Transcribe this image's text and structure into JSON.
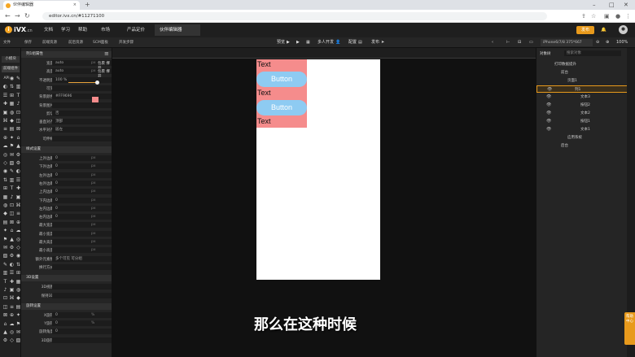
{
  "browser": {
    "tab_title": "伙伴编辑器",
    "url": "editor.ivx.cn/#11271100",
    "new_tab": "+",
    "tab_close": "×"
  },
  "app": {
    "logo_text": "iVX",
    "logo_sub": ".cn",
    "menus": [
      "文档",
      "学习",
      "帮助",
      "市场",
      "产品定价"
    ],
    "project_tab": "伙伴编辑器",
    "publish_label": "发布"
  },
  "toolbar": {
    "left": [
      "文件",
      "保存",
      "前端资源",
      "前后资源",
      "SCM面板",
      "开发步骤"
    ],
    "center": [
      "预览",
      "多人开发",
      "配置",
      "发布"
    ],
    "device": "iPhone6/7/8 375*667",
    "zoom": "100%"
  },
  "sidebar": {
    "top_label": "小模块",
    "active_label": "前端组件",
    "rows": [
      [
        "API",
        "",
        "",
        ""
      ],
      [
        "",
        "",
        "",
        ""
      ],
      [
        "",
        "",
        "",
        ""
      ],
      [
        "",
        "",
        "",
        ""
      ],
      [
        "",
        "",
        "",
        ""
      ],
      [
        "",
        "",
        "",
        ""
      ],
      [
        "",
        "",
        "",
        ""
      ],
      [
        "",
        "",
        "",
        ""
      ],
      [
        "",
        "",
        "",
        ""
      ],
      [
        "",
        "",
        "",
        ""
      ],
      [
        "",
        "",
        "",
        ""
      ],
      [
        "",
        "",
        "",
        ""
      ],
      [
        "",
        "",
        "",
        ""
      ],
      [
        "",
        "",
        "",
        ""
      ],
      [
        "",
        "",
        "",
        ""
      ],
      [
        "",
        "",
        "",
        ""
      ],
      [
        "",
        "",
        "",
        ""
      ],
      [
        "",
        "",
        "",
        ""
      ],
      [
        "",
        "",
        "",
        ""
      ],
      [
        "",
        "",
        "",
        ""
      ],
      [
        "",
        "",
        "",
        ""
      ],
      [
        "",
        "",
        "",
        ""
      ],
      [
        "",
        "",
        "",
        ""
      ],
      [
        "",
        "",
        "",
        ""
      ],
      [
        "",
        "",
        "",
        ""
      ],
      [
        "",
        "",
        "",
        ""
      ],
      [
        "",
        "",
        "",
        ""
      ],
      [
        "",
        "",
        "",
        ""
      ],
      [
        "",
        "",
        "",
        ""
      ],
      [
        "",
        "",
        "",
        ""
      ],
      [
        "",
        "",
        "",
        ""
      ],
      [
        "",
        "",
        "",
        ""
      ]
    ]
  },
  "props": {
    "header": "列1组属性",
    "rows": [
      {
        "label": "宽度",
        "value": "auto",
        "unit": "px",
        "extra": "包裹 撑开"
      },
      {
        "label": "高度",
        "value": "auto",
        "unit": "px",
        "extra": "包裹 撑开"
      },
      {
        "label": "不透明度",
        "value": "100 %"
      },
      {
        "label": "可见",
        "value": ""
      },
      {
        "label": "背景颜色",
        "value": "#FF9696"
      },
      {
        "label": "背景图片",
        "value": ""
      },
      {
        "label": "剪切",
        "value": "否"
      },
      {
        "label": "垂直对齐",
        "value": "顶部"
      },
      {
        "label": "水平对齐",
        "value": "居左"
      },
      {
        "label": "可伸缩",
        "value": ""
      }
    ],
    "section2": "样式设置",
    "rows2": [
      {
        "label": "上外边距",
        "value": "0",
        "unit": "px"
      },
      {
        "label": "下外边距",
        "value": "0",
        "unit": "px"
      },
      {
        "label": "左外边距",
        "value": "0",
        "unit": "px"
      },
      {
        "label": "右外边距",
        "value": "0",
        "unit": "px"
      },
      {
        "label": "上内边距",
        "value": "0",
        "unit": "px"
      },
      {
        "label": "下内边距",
        "value": "0",
        "unit": "px"
      },
      {
        "label": "左内边距",
        "value": "0",
        "unit": "px"
      },
      {
        "label": "右内边距",
        "value": "0",
        "unit": "px"
      },
      {
        "label": "最大宽度",
        "value": "",
        "unit": "px"
      },
      {
        "label": "最小宽度",
        "value": "",
        "unit": "px"
      },
      {
        "label": "最大高度",
        "value": "",
        "unit": "px"
      },
      {
        "label": "最小高度",
        "value": "",
        "unit": "px"
      },
      {
        "label": "额外元素数",
        "value": "多个可见 可分组"
      },
      {
        "label": "换行方式",
        "value": ""
      }
    ],
    "section3": "3D设置",
    "rows3": [
      {
        "label": "3D视图",
        "value": ""
      },
      {
        "label": "保持3D",
        "value": ""
      }
    ],
    "section4": "旋转设置",
    "rows4": [
      {
        "label": "X旋转",
        "value": "0",
        "unit": "%"
      },
      {
        "label": "Y旋转",
        "value": "0",
        "unit": "%"
      },
      {
        "label": "旋转角度",
        "value": "0"
      },
      {
        "label": "3D旋转",
        "value": ""
      }
    ]
  },
  "canvas": {
    "texts": [
      "Text",
      "Text",
      "Text"
    ],
    "buttons": [
      "Button",
      "Button"
    ],
    "col_color": "#f58c8c",
    "btn_color": "#8ecbf2"
  },
  "tree": {
    "header": "对象树",
    "search_placeholder": "搜索对象",
    "nodes": [
      {
        "label": "打印数据提升",
        "indent": 0
      },
      {
        "label": "前台",
        "indent": 1
      },
      {
        "label": "页面1",
        "indent": 2
      },
      {
        "label": "列1",
        "indent": 3,
        "selected": true
      },
      {
        "label": "文本3",
        "indent": 4
      },
      {
        "label": "按钮2",
        "indent": 4
      },
      {
        "label": "文本2",
        "indent": 4
      },
      {
        "label": "按钮1",
        "indent": 4
      },
      {
        "label": "文本1",
        "indent": 4
      },
      {
        "label": "应用系统",
        "indent": 2
      },
      {
        "label": "后台",
        "indent": 1
      }
    ]
  },
  "subtitle": "那么在这种时候",
  "help_label": "帮助中心"
}
